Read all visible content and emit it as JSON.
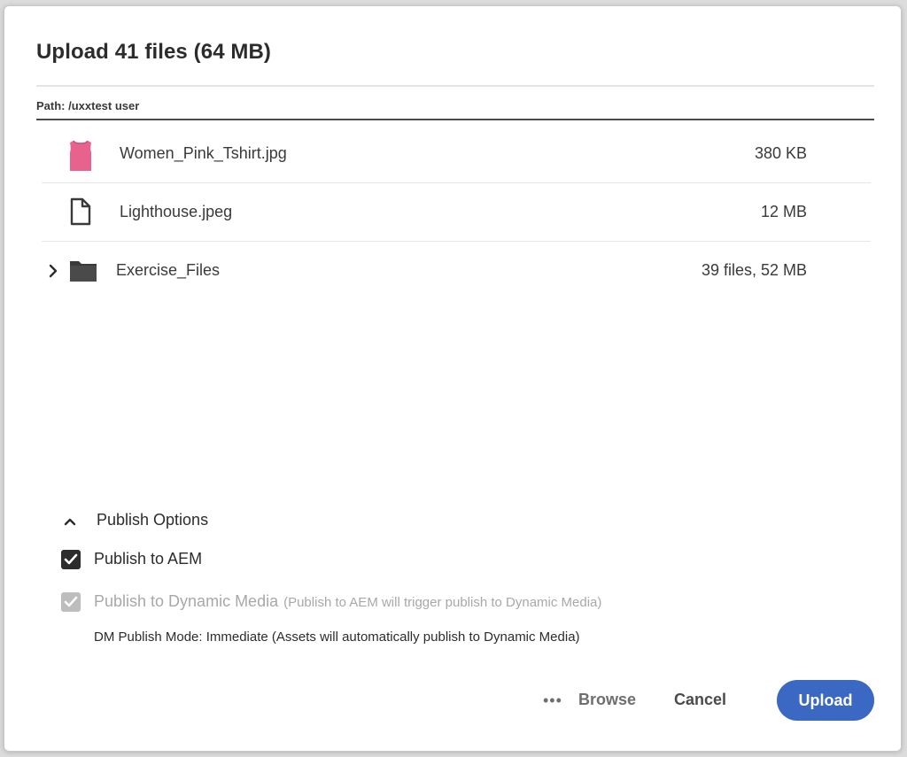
{
  "dialog": {
    "title": "Upload 41 files (64 MB)",
    "path": "Path: /uxxtest user"
  },
  "files": [
    {
      "name": "Women_Pink_Tshirt.jpg",
      "size": "380 KB",
      "icon": "pink-tshirt-thumbnail"
    },
    {
      "name": "Lighthouse.jpeg",
      "size": "12 MB",
      "icon": "document-icon"
    },
    {
      "name": "Exercise_Files",
      "size": "39 files, 52 MB",
      "icon": "folder-icon",
      "expandable": true
    }
  ],
  "publish": {
    "header": "Publish Options",
    "to_aem": {
      "label": "Publish to AEM",
      "checked": true
    },
    "to_dm": {
      "label": "Publish to Dynamic Media",
      "hint": "(Publish to AEM will trigger publish to Dynamic Media)",
      "checked": true,
      "disabled": true
    },
    "dm_mode": "DM Publish Mode:  Immediate  (Assets will automatically publish to Dynamic Media)"
  },
  "actions": {
    "browse_dots": "•••",
    "browse": "Browse",
    "cancel": "Cancel",
    "upload": "Upload"
  },
  "colors": {
    "accent": "#3a68c2",
    "tshirt": "#e8628e",
    "text": "#2c2c2c",
    "muted": "#a8a8a8"
  }
}
